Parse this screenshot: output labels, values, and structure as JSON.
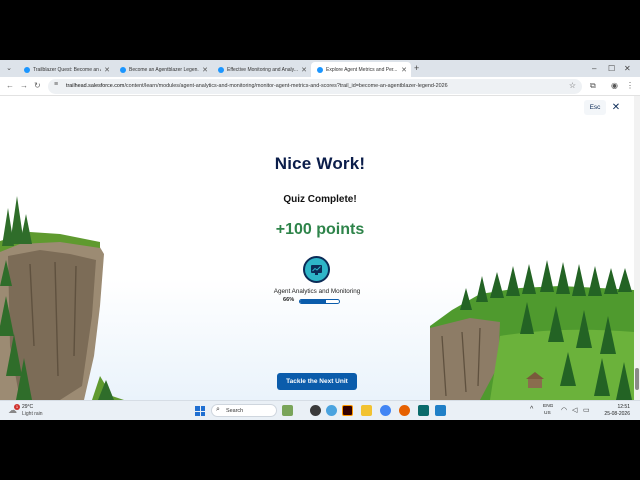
{
  "browser": {
    "tabs": [
      {
        "label": "Trailblazer Quest: Become an A...",
        "active": false
      },
      {
        "label": "Become an Agentblazer Legen...",
        "active": false
      },
      {
        "label": "Effective Monitoring and Analy...",
        "active": false
      },
      {
        "label": "Explore Agent Metrics and Per...",
        "active": true
      }
    ],
    "url_host": "trailhead.salesforce.com",
    "url_path": "/content/learn/modules/agent-analytics-and-monitoring/monitor-agent-metrics-and-scores?trail_id=become-an-agentblazer-legend-2026"
  },
  "page": {
    "esc_label": "Esc",
    "headline": "Nice Work!",
    "subheadline": "Quiz Complete!",
    "points": "+100 points",
    "module_name": "Agent Analytics and Monitoring",
    "progress_label": "66%",
    "progress_fraction": 0.66,
    "next_button_label": "Tackle the Next Unit"
  },
  "taskbar": {
    "weather_badge": "1",
    "weather_temp": "29°C",
    "weather_cond": "Light rain",
    "search_label": "Search",
    "lang_top": "ENG",
    "lang_bottom": "US",
    "time": "12:51",
    "date": "25-08-2026"
  },
  "colors": {
    "accent_blue": "#0b5cab",
    "points_green": "#2e844a",
    "headline_navy": "#0b1d4a"
  }
}
